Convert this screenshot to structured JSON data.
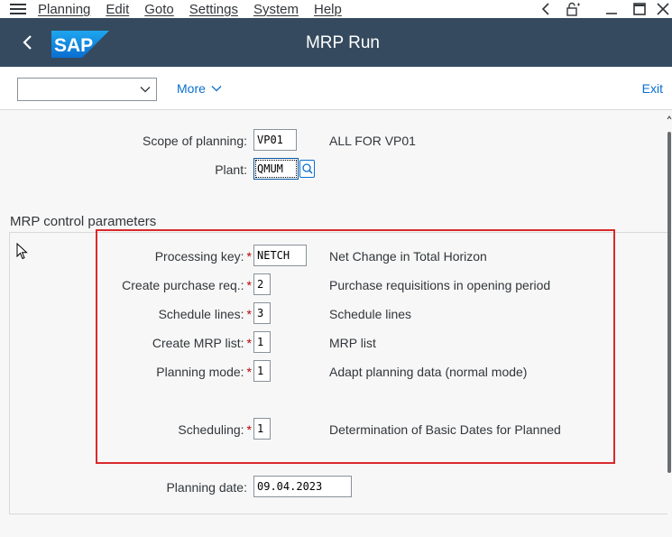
{
  "menubar": {
    "items": [
      "Planning",
      "Edit",
      "Goto",
      "Settings",
      "System",
      "Help"
    ]
  },
  "window_controls": [
    "back-arrow-icon",
    "lock-icon",
    "minimize-icon",
    "maximize-icon",
    "close-icon"
  ],
  "shell": {
    "logo_text": "SAP",
    "title": "MRP Run",
    "brand_color": "#354a5f",
    "logo_color": "#0a6ed1"
  },
  "toolbar": {
    "variant_value": "",
    "more_label": "More",
    "exit_label": "Exit"
  },
  "header_fields": {
    "scope": {
      "label": "Scope of planning:",
      "value": "VP01",
      "desc": "ALL FOR VP01"
    },
    "plant": {
      "label": "Plant:",
      "value": "QMUM"
    }
  },
  "control_params": {
    "title": "MRP control parameters",
    "rows": [
      {
        "label": "Processing key:",
        "value": "NETCH",
        "desc": "Net Change in Total Horizon",
        "required": "*"
      },
      {
        "label": "Create purchase req.:",
        "value": "2",
        "desc": "Purchase requisitions in opening period",
        "required": "*"
      },
      {
        "label": "Schedule lines:",
        "value": "3",
        "desc": "Schedule lines",
        "required": "*"
      },
      {
        "label": "Create MRP list:",
        "value": "1",
        "desc": "MRP list",
        "required": "*"
      },
      {
        "label": "Planning mode:",
        "value": "1",
        "desc": "Adapt planning data (normal mode)",
        "required": "*"
      },
      {
        "label": "Scheduling:",
        "value": "1",
        "desc": "Determination of Basic Dates for Planned",
        "required": "*"
      }
    ],
    "planning_date": {
      "label": "Planning date:",
      "value": "09.04.2023"
    }
  },
  "colors": {
    "highlight": "#d9292b",
    "required": "#bb0000",
    "link": "#0a6ed1"
  }
}
